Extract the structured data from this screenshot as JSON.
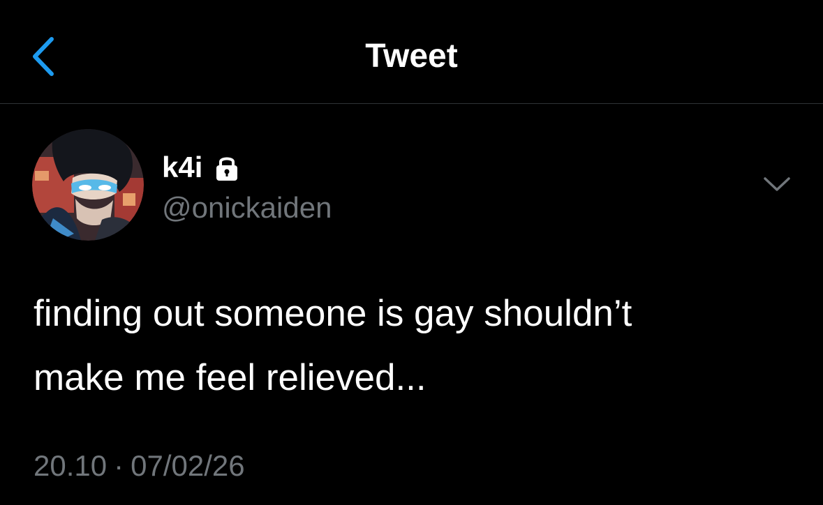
{
  "header": {
    "title": "Tweet",
    "back_icon": "chevron-left-icon",
    "accent_color": "#1d9bf0"
  },
  "tweet": {
    "author": {
      "display_name": "k4i",
      "handle": "@onickaiden",
      "protected_icon": "lock-icon",
      "avatar": "avatar-image"
    },
    "more_icon": "chevron-down-icon",
    "text_lines": [
      "finding out someone is gay shouldn’t",
      "make me feel relieved..."
    ],
    "time": "20.10",
    "separator": "·",
    "date": "07/02/26"
  },
  "colors": {
    "background": "#000000",
    "primary_text": "#ffffff",
    "secondary_text": "#71767b",
    "divider": "#2f3336"
  }
}
